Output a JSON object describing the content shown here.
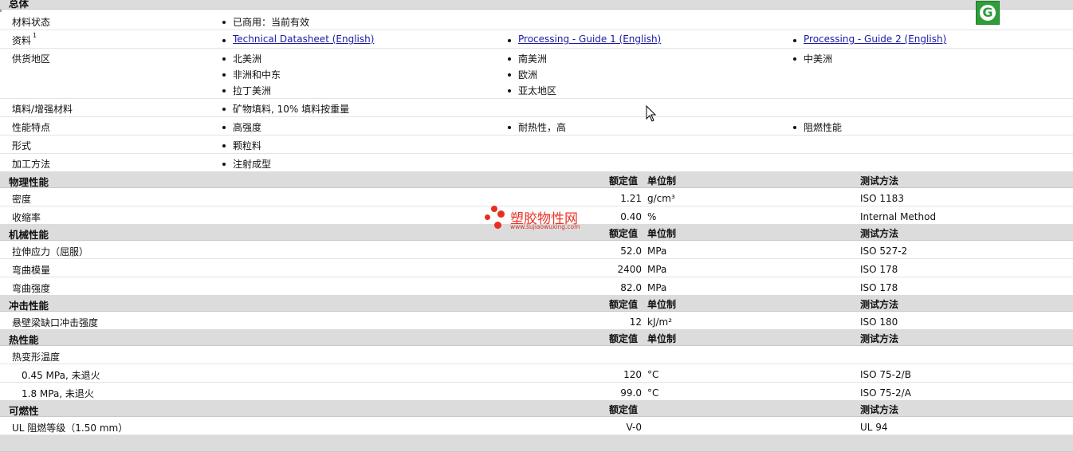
{
  "general": {
    "title": "总体",
    "rows": [
      {
        "label": "材料状态",
        "items": [
          "已商用：当前有效"
        ]
      },
      {
        "label": "资料",
        "sup": "1",
        "links": [
          "Technical Datasheet (English)",
          "Processing - Guide 1 (English)",
          "Processing - Guide 2 (English)"
        ]
      },
      {
        "label": "供货地区",
        "items": [
          "北美洲",
          "南美洲",
          "中美洲",
          "非洲和中东",
          "欧洲",
          "拉丁美洲",
          "亚太地区"
        ]
      },
      {
        "label": "填料/增强材料",
        "items": [
          "矿物填料, 10% 填料按重量"
        ]
      },
      {
        "label": "性能特点",
        "items": [
          "高强度",
          "耐热性，高",
          "阻燃性能"
        ]
      },
      {
        "label": "形式",
        "items": [
          "颗粒料"
        ]
      },
      {
        "label": "加工方法",
        "items": [
          "注射成型"
        ]
      }
    ]
  },
  "columns": {
    "value": "额定值",
    "unit": "单位制",
    "test": "测试方法"
  },
  "sections": [
    {
      "title": "物理性能",
      "rows": [
        {
          "label": "密度",
          "value": "1.21",
          "unit": "g/cm³",
          "test": "ISO 1183"
        },
        {
          "label": "收缩率",
          "value": "0.40",
          "unit": "%",
          "test": "Internal Method"
        }
      ]
    },
    {
      "title": "机械性能",
      "rows": [
        {
          "label": "拉伸应力（屈服）",
          "value": "52.0",
          "unit": "MPa",
          "test": "ISO 527-2"
        },
        {
          "label": "弯曲模量",
          "value": "2400",
          "unit": "MPa",
          "test": "ISO 178"
        },
        {
          "label": "弯曲强度",
          "value": "82.0",
          "unit": "MPa",
          "test": "ISO 178"
        }
      ]
    },
    {
      "title": "冲击性能",
      "rows": [
        {
          "label": "悬壁梁缺口冲击强度",
          "value": "12",
          "unit": "kJ/m²",
          "test": "ISO 180"
        }
      ]
    },
    {
      "title": "热性能",
      "rows": [
        {
          "label": "热变形温度",
          "value": "",
          "unit": "",
          "test": ""
        },
        {
          "label": "0.45 MPa, 未退火",
          "value": "120",
          "unit": "°C",
          "test": "ISO 75-2/B"
        },
        {
          "label": "1.8 MPa, 未退火",
          "value": "99.0",
          "unit": "°C",
          "test": "ISO 75-2/A"
        }
      ]
    },
    {
      "title": "可燃性",
      "rows": [
        {
          "label": "UL 阻燃等级（1.50 mm）",
          "value": "V-0",
          "unit": "",
          "test": "UL 94"
        }
      ]
    }
  ],
  "watermark": {
    "name": "塑胶物性网",
    "url": "www.sujiaowuxing.com"
  },
  "badge_letter": "G"
}
